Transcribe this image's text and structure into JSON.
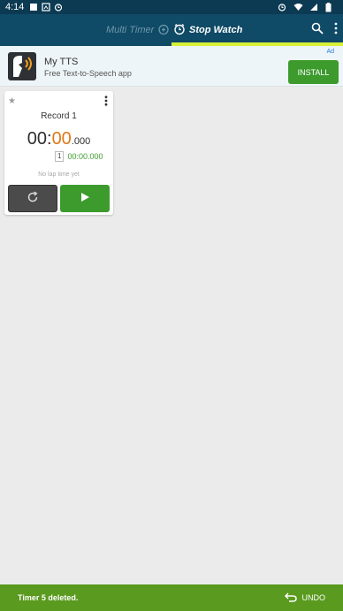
{
  "status_bar": {
    "time": "4:14"
  },
  "tabs": [
    {
      "label": "Multi Timer",
      "icon": "alarm-add-icon"
    },
    {
      "label": "Stop Watch",
      "icon": "alarm-clock-icon"
    }
  ],
  "colors": {
    "appbar": "#0f4a66",
    "tab_indicator": "#d7f03a",
    "accent_green": "#3d9b2e",
    "accent_orange": "#e07818",
    "snackbar": "#5a9a1f"
  },
  "ad": {
    "tag": "Ad",
    "title": "My TTS",
    "subtitle": "Free Text-to-Speech app",
    "install_label": "INSTALL"
  },
  "stopwatch": {
    "name": "Record 1",
    "time_minutes": "00:",
    "time_seconds": "00",
    "time_millis": ".000",
    "lap_number": "1",
    "lap_time": "00:00.000",
    "no_lap_text": "No lap time yet"
  },
  "snackbar": {
    "message": "Timer 5 deleted.",
    "action_label": "UNDO"
  }
}
